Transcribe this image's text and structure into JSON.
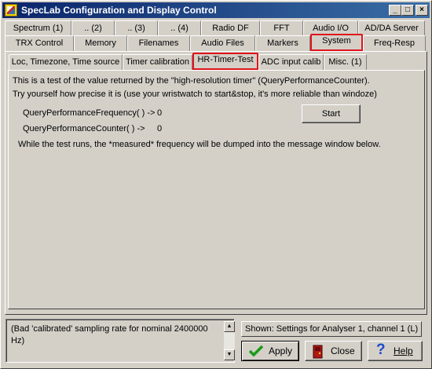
{
  "window": {
    "title": "SpecLab  Configuration and Display Control",
    "controls": {
      "minimize": "_",
      "maximize": "□",
      "close": "×"
    }
  },
  "tabs": {
    "row1": [
      "Spectrum (1)",
      ".. (2)",
      ".. (3)",
      ".. (4)",
      "Radio DF",
      "FFT",
      "Audio I/O",
      "AD/DA Server"
    ],
    "row2": [
      "TRX Control",
      "Memory",
      "Filenames",
      "Audio Files",
      "Markers",
      "System",
      "Freq-Resp"
    ],
    "selected_main": "System"
  },
  "subtabs": {
    "items": [
      "Loc, Timezone, Time source",
      "Timer calibration",
      "HR-Timer-Test",
      "ADC input calib",
      "Misc. (1)"
    ],
    "selected": "HR-Timer-Test"
  },
  "content": {
    "intro_line1": "This is a test of the value returned by the \"high-resolution timer\" (QueryPerformanceCounter).",
    "intro_line2": "Try yourself how precise it is (use your wristwatch to start&stop, it's more reliable than windoze)",
    "freq_label": "QueryPerformanceFrequency( ) ->",
    "freq_value": "0",
    "counter_label": "QueryPerformanceCounter( ) ->",
    "counter_value": "0",
    "start_button": "Start",
    "note": "While the test runs, the *measured* frequency will be dumped into the message window below."
  },
  "footer": {
    "message": "(Bad 'calibrated' sampling rate for nominal 2400000 Hz)",
    "shown_label": "Shown: Settings for Analyser 1, channel 1 (L)",
    "apply": "Apply",
    "close": "Close",
    "help": "Help"
  },
  "colors": {
    "selected_tab_outline": "#e0141c",
    "title_bar": "#0a246a",
    "face": "#d4d0c8"
  }
}
